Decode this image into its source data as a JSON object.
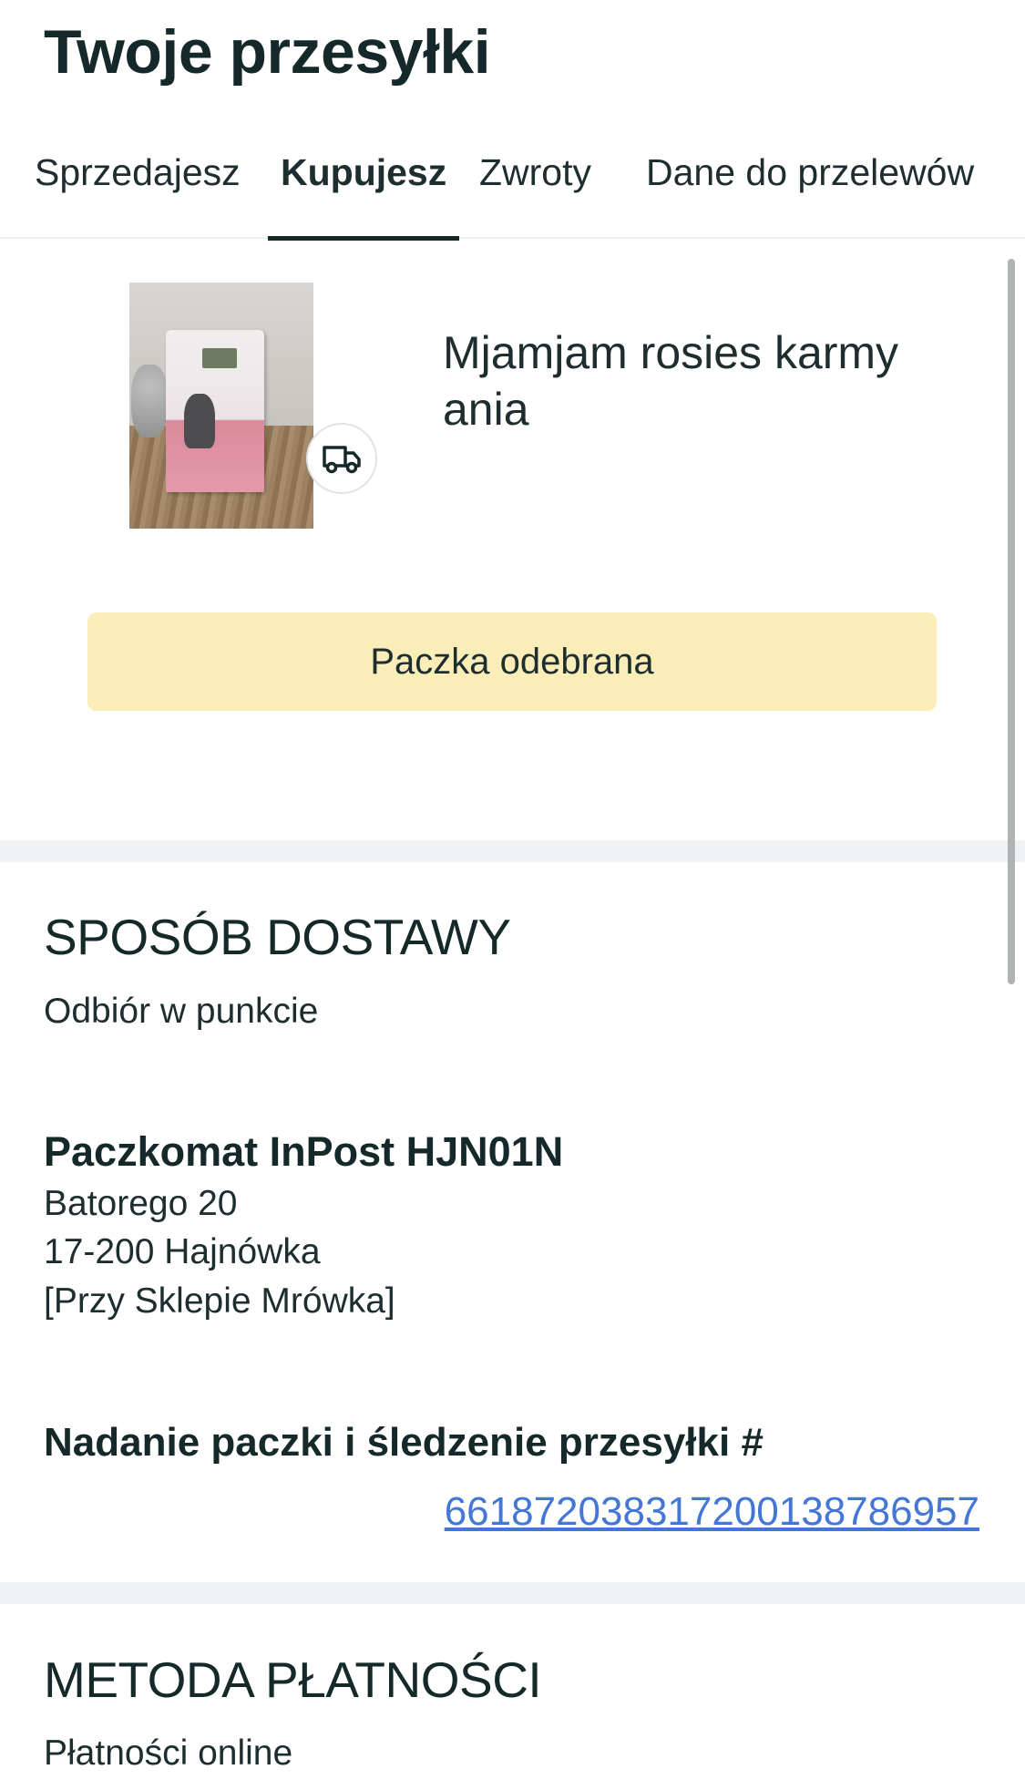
{
  "header": {
    "title": "Twoje przesyłki"
  },
  "tabs": [
    {
      "label": "Sprzedajesz",
      "active": false
    },
    {
      "label": "Kupujesz",
      "active": true
    },
    {
      "label": "Zwroty",
      "active": false
    },
    {
      "label": "Dane do przelewów",
      "active": false
    }
  ],
  "item": {
    "title": "Mjamjam rosies karmy ania",
    "badge_icon": "truck-icon",
    "status_label": "Paczka odebrana"
  },
  "delivery": {
    "heading": "SPOSÓB DOSTAWY",
    "method": "Odbiór w punkcie",
    "point_name": "Paczkomat InPost HJN01N",
    "address_line1": "Batorego 20",
    "address_line2": "17-200 Hajnówka",
    "address_line3": "[Przy Sklepie Mrówka]",
    "tracking_label": "Nadanie paczki i śledzenie przesyłki #",
    "tracking_number": "661872038317200138786957"
  },
  "payment": {
    "heading": "METODA PŁATNOŚCI",
    "method": "Płatności online"
  },
  "colors": {
    "status_bg": "#faedb8",
    "link": "#4476d6",
    "text": "#15292b"
  }
}
